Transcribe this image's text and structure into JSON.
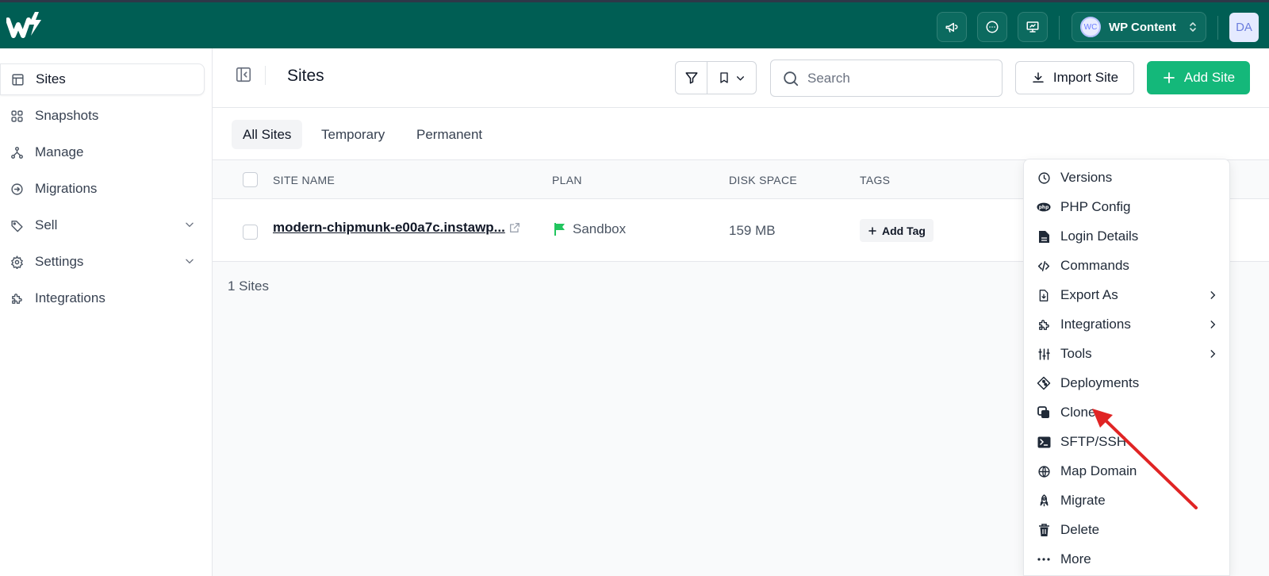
{
  "topbar": {
    "workspace_initials": "WC",
    "workspace_name": "WP Content",
    "user_initials": "DA"
  },
  "sidebar": {
    "items": [
      {
        "label": "Sites",
        "icon": "layout-icon"
      },
      {
        "label": "Snapshots",
        "icon": "grid-icon"
      },
      {
        "label": "Manage",
        "icon": "hierarchy-icon"
      },
      {
        "label": "Migrations",
        "icon": "arrow-circle-icon"
      },
      {
        "label": "Sell",
        "icon": "tag-icon"
      },
      {
        "label": "Settings",
        "icon": "gear-icon"
      },
      {
        "label": "Integrations",
        "icon": "puzzle-icon"
      }
    ]
  },
  "header": {
    "title": "Sites",
    "search_placeholder": "Search",
    "import_label": "Import Site",
    "add_label": "Add Site"
  },
  "tabs": [
    "All Sites",
    "Temporary",
    "Permanent"
  ],
  "table": {
    "columns": [
      "SITE NAME",
      "PLAN",
      "DISK SPACE",
      "TAGS"
    ],
    "rows": [
      {
        "site_name": "modern-chipmunk-e00a7c.instawp...",
        "plan": "Sandbox",
        "disk_space": "159 MB",
        "tag_action": "Add Tag"
      }
    ],
    "count_text": "1 Sites"
  },
  "menu": {
    "items": [
      {
        "label": "Versions",
        "icon": "clock-icon",
        "submenu": false
      },
      {
        "label": "PHP Config",
        "icon": "php-icon",
        "submenu": false
      },
      {
        "label": "Login Details",
        "icon": "document-icon",
        "submenu": false
      },
      {
        "label": "Commands",
        "icon": "code-icon",
        "submenu": false
      },
      {
        "label": "Export As",
        "icon": "file-download-icon",
        "submenu": true
      },
      {
        "label": "Integrations",
        "icon": "puzzle-icon",
        "submenu": true
      },
      {
        "label": "Tools",
        "icon": "sliders-icon",
        "submenu": true
      },
      {
        "label": "Deployments",
        "icon": "git-icon",
        "submenu": false
      },
      {
        "label": "Clone",
        "icon": "copy-icon",
        "submenu": false
      },
      {
        "label": "SFTP/SSH",
        "icon": "terminal-icon",
        "submenu": false
      },
      {
        "label": "Map Domain",
        "icon": "globe-icon",
        "submenu": false
      },
      {
        "label": "Migrate",
        "icon": "rocket-icon",
        "submenu": false
      },
      {
        "label": "Delete",
        "icon": "trash-icon",
        "submenu": false
      },
      {
        "label": "More",
        "icon": "dots-icon",
        "submenu": false
      }
    ]
  },
  "colors": {
    "topbar": "#005e54",
    "primary": "#14b87a",
    "annotation_arrow": "#e02424"
  }
}
